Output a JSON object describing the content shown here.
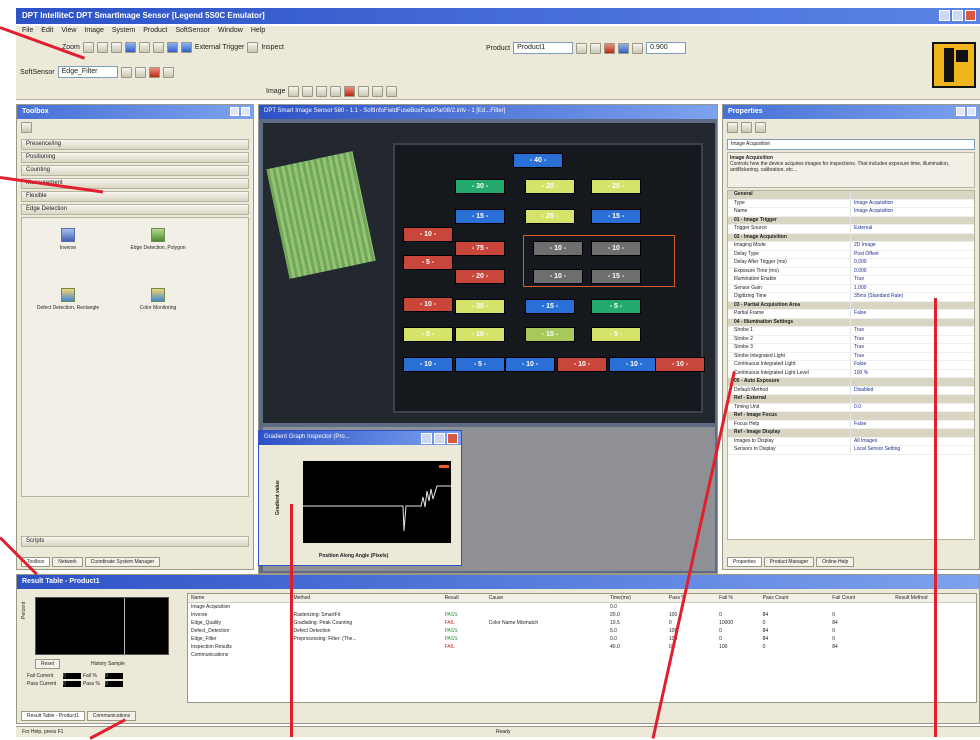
{
  "app": {
    "title": "DPT IntelliteC  DPT SmartImage Sensor [Legend 5S0C Emulator]",
    "menu": [
      "File",
      "Edit",
      "View",
      "Image",
      "System",
      "Product",
      "SoftSensor",
      "Window",
      "Help"
    ]
  },
  "toolbar": {
    "zoom_label": "Zoom",
    "external_trigger_label": "External Trigger",
    "inspect_label": "Inspect",
    "product_label": "Product",
    "product_value": "Product1",
    "softsensor_label": "SoftSensor",
    "softsensor_value": "Edge_Filter",
    "zoom_value": "0.900",
    "image_label": "Image"
  },
  "toolbox": {
    "title": "Toolbox",
    "categories": [
      "Presence/ing",
      "Positioning",
      "Counting",
      "Measurement",
      "Flexible"
    ],
    "open_category": "Edge Detection",
    "tools": [
      "Inverse",
      "Edge Detection, Polygon",
      "Defect Detection, Rectangle",
      "Color Monitoring"
    ],
    "scripts_label": "Scripts",
    "tabs": [
      "Toolbox",
      "Network",
      "Coordinate System Manager"
    ]
  },
  "image_window": {
    "title": "DPT Smart Image Sensor 580 - 1.1 - SoftInfoFieldFuseBoxFusePar08/2.intv - 1 [Ed...Filter]"
  },
  "fuses": [
    "- 40 -",
    "- 30 -",
    "- 20 -",
    "- 20 -",
    "- 15 -",
    "- 25 -",
    "- 15 -",
    "- 10 -",
    "- 75 -",
    "- 5 -",
    "- 10 -",
    "- 10 -",
    "- 20 -",
    "- 10 -",
    "- 15 -",
    "- 10 -",
    "- 30 -",
    "- 15 -",
    "- 5 -",
    "- 5 -",
    "- 10 -",
    "- 15 -",
    "- 5 -",
    "- 10 -",
    "- 5 -",
    "- 10 -",
    "- 10 -",
    "- 10 -",
    "- 10 -"
  ],
  "graph": {
    "title": "Gradient Graph Inspector (Pro...",
    "xlabel": "Position Along Angle (Pixels)",
    "ylabel": "Gradient value"
  },
  "properties": {
    "title": "Properties",
    "selected": "Image Acquisition",
    "desc_title": "Image Acquisition",
    "desc_text": "Controls how the device acquires images for inspections. That includes exposure time, illumination, antiflickering, calibration, etc...",
    "rows": [
      {
        "k": "General",
        "v": "",
        "sec": true
      },
      {
        "k": "Type",
        "v": "Image Acquisition"
      },
      {
        "k": "Name",
        "v": "Image Acquisition"
      },
      {
        "k": "01 - Image Trigger",
        "v": "",
        "sec": true
      },
      {
        "k": "Trigger Source",
        "v": "External"
      },
      {
        "k": "02 - Image Acquisition",
        "v": "",
        "sec": true
      },
      {
        "k": "Imaging Mode",
        "v": "2D Image"
      },
      {
        "k": "Delay Type",
        "v": "Post Offset"
      },
      {
        "k": "Delay After Trigger (ms)",
        "v": "0.000"
      },
      {
        "k": "Exposure Time (ms)",
        "v": "0.000"
      },
      {
        "k": "Illumination Enable",
        "v": "True"
      },
      {
        "k": "Sensor Gain",
        "v": "1.000"
      },
      {
        "k": "Digitizing Time",
        "v": "35ms (Standard Rate)"
      },
      {
        "k": "03 - Partial Acquisition Area",
        "v": "",
        "sec": true
      },
      {
        "k": "Partial Frame",
        "v": "False"
      },
      {
        "k": "04 - Illumination Settings",
        "v": "",
        "sec": true
      },
      {
        "k": "Strobe 1",
        "v": "True"
      },
      {
        "k": "Strobe 2",
        "v": "True"
      },
      {
        "k": "Strobe 3",
        "v": "True"
      },
      {
        "k": "Strobe Integrated Light",
        "v": "True"
      },
      {
        "k": "Continuous Integrated Light",
        "v": "False"
      },
      {
        "k": "Continuous Integrated Light Level",
        "v": "100 %"
      },
      {
        "k": "05 - Auto Exposure",
        "v": "",
        "sec": true
      },
      {
        "k": "Default Method",
        "v": "Disabled"
      },
      {
        "k": "Ref - External",
        "v": "",
        "sec": true
      },
      {
        "k": "Timing Unit",
        "v": "0.0"
      },
      {
        "k": "Ref - Image Focus",
        "v": "",
        "sec": true
      },
      {
        "k": "Focus Help",
        "v": "False"
      },
      {
        "k": "Ref - Image Display",
        "v": "",
        "sec": true
      },
      {
        "k": "Images to Display",
        "v": "All Images"
      },
      {
        "k": "Sensors to Display",
        "v": "Local Sensor Setting"
      }
    ],
    "tabs": [
      "Properties",
      "Product Manager",
      "Online Help"
    ]
  },
  "result_table": {
    "title": "Result Table - Product1",
    "ylabel": "Percent",
    "xlabel": "History Sample",
    "reset_label": "Reset",
    "stats": [
      {
        "label": "Fail Current",
        "value": "0"
      },
      {
        "label": "Fail %",
        "value": "0"
      },
      {
        "label": "Pass Current",
        "value": "0"
      },
      {
        "label": "Pass %",
        "value": "0"
      }
    ],
    "columns": [
      "Name",
      "Method",
      "Result",
      "Cause",
      "Time(ms)",
      "Pass %",
      "Fail %",
      "Pass Count",
      "Fail Count",
      "Result Method"
    ],
    "rows": [
      {
        "name": "Image Acquisition",
        "method": "",
        "result": "",
        "cause": "",
        "time": "0.0",
        "pass": "",
        "fail": "",
        "pc": "",
        "fc": "",
        "rm": ""
      },
      {
        "name": "Inverse",
        "method": "Rasterizing: SmartFit",
        "result": "PASS",
        "cause": "",
        "time": "20.0",
        "pass": "100",
        "fail": "0",
        "pc": "84",
        "fc": "0",
        "rm": ""
      },
      {
        "name": "Edge_Quality",
        "method": "Gradiating: Peak Counting",
        "result": "FAIL",
        "cause": "Color Name Mismatch",
        "time": "10.5",
        "pass": "0",
        "fail": "10000",
        "pc": "0",
        "fc": "84",
        "rm": ""
      },
      {
        "name": "Defect_Detection",
        "method": "Defect Detection",
        "result": "PASS",
        "cause": "",
        "time": "5.0",
        "pass": "100",
        "fail": "0",
        "pc": "84",
        "fc": "0",
        "rm": ""
      },
      {
        "name": "Edge_Filter",
        "method": "Preprocessing: Filter: (The...",
        "result": "PASS",
        "cause": "",
        "time": "0.0",
        "pass": "100",
        "fail": "0",
        "pc": "84",
        "fc": "0",
        "rm": ""
      },
      {
        "name": "Inspection Results",
        "method": "",
        "result": "FAIL",
        "cause": "",
        "time": "40.0",
        "pass": "0",
        "fail": "100",
        "pc": "0",
        "fc": "84",
        "rm": ""
      },
      {
        "name": "Communications",
        "method": "",
        "result": "",
        "cause": "",
        "time": "",
        "pass": "",
        "fail": "",
        "pc": "",
        "fc": "",
        "rm": ""
      }
    ],
    "tabs": [
      "Result Table - Product1",
      "Communications"
    ]
  },
  "status": {
    "left": "For Help, press F1",
    "center": "Ready"
  },
  "colors": {
    "title_blue": "#2d52c6",
    "callout_red": "#e0202e",
    "pass_green": "#2f8f2f",
    "fail_red": "#d2311a"
  }
}
